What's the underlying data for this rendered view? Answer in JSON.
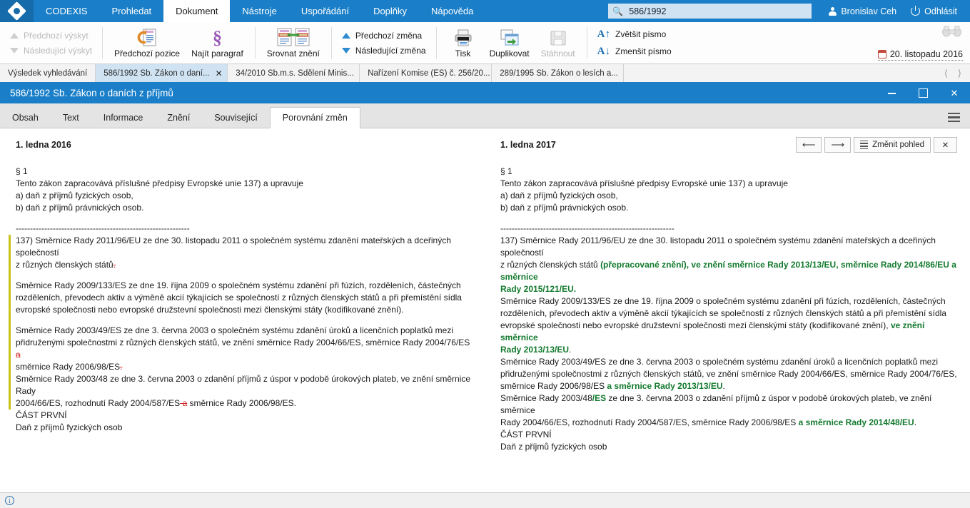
{
  "menubar": {
    "logo_icon": "codexis-diamond-logo",
    "items": [
      {
        "label": "CODEXIS",
        "active": false
      },
      {
        "label": "Prohledat",
        "active": false
      },
      {
        "label": "Dokument",
        "active": true
      },
      {
        "label": "Nástroje",
        "active": false
      },
      {
        "label": "Uspořádání",
        "active": false
      },
      {
        "label": "Doplňky",
        "active": false
      },
      {
        "label": "Nápověda",
        "active": false
      }
    ],
    "search": {
      "value": "586/1992",
      "placeholder": "",
      "icon": "search-icon"
    },
    "user": {
      "name": "Bronislav Ceh",
      "icon": "person-icon"
    },
    "logout": {
      "label": "Odhlásit",
      "icon": "power-icon"
    }
  },
  "ribbon": {
    "nav": {
      "prev_occurrence": "Předchozí výskyt",
      "next_occurrence": "Následující výskyt"
    },
    "prev_position": "Předchozí pozice",
    "find_paragraph": "Najít paragraf",
    "compare_versions": "Srovnat znění",
    "changes": {
      "prev_change": "Předchozí změna",
      "next_change": "Následující změna"
    },
    "print": "Tisk",
    "duplicate": "Duplikovat",
    "download": "Stáhnout",
    "font": {
      "increase": "Zvětšit písmo",
      "decrease": "Zmenšit písmo"
    },
    "binoculars_icon": "binoculars-icon",
    "date": "20. listopadu 2016",
    "date_icon": "calendar-icon"
  },
  "doctabs": {
    "items": [
      {
        "label": "Výsledek vyhledávání",
        "selected": false,
        "closable": false
      },
      {
        "label": "586/1992 Sb. Zákon o daní...",
        "selected": true,
        "closable": true
      },
      {
        "label": "34/2010 Sb.m.s. Sdělení Minis...",
        "selected": false,
        "closable": false
      },
      {
        "label": "Nařízení Komise (ES) č. 256/20...",
        "selected": false,
        "closable": false
      },
      {
        "label": "289/1995 Sb. Zákon o lesích a...",
        "selected": false,
        "closable": false
      }
    ],
    "nav_prev_icon": "chevron-left-icon",
    "nav_next_icon": "chevron-right-icon"
  },
  "window": {
    "title": "586/1992 Sb. Zákon o daních z příjmů",
    "minimize_icon": "minimize-icon",
    "maximize_icon": "maximize-icon",
    "close_icon": "close-icon"
  },
  "inner_tabs": {
    "items": [
      {
        "label": "Obsah",
        "active": false
      },
      {
        "label": "Text",
        "active": false
      },
      {
        "label": "Informace",
        "active": false
      },
      {
        "label": "Znění",
        "active": false
      },
      {
        "label": "Související",
        "active": false
      },
      {
        "label": "Porovnání změn",
        "active": true
      }
    ],
    "menu_icon": "hamburger-menu-icon"
  },
  "compare": {
    "left": {
      "date": "1. ledna 2016",
      "section": "§ 1",
      "intro": "Tento zákon zapracovává příslušné předpisy Evropské unie 137) a upravuje",
      "item_a": "a) daň z příjmů fyzických osob,",
      "item_b": "b) daň z příjmů právnických osob.",
      "divider": "-------------------------------------------------------------",
      "note137_p1": "137) Směrnice Rady 2011/96/EU ze dne 30. listopadu 2011 o společném systému zdanění mateřských a dceřiných společností",
      "note137_p2_pre": "z různých členských států",
      "note137_p2_del": ".",
      "note133_p1": "Směrnice Rady 2009/133/ES ze dne 19. října 2009 o společném systému zdanění při fúzích, rozděleních, částečných",
      "note133_p2": "rozděleních, převodech aktiv a výměně akcií týkajících se společností z různých členských států a při přemístění sídla",
      "note133_p3": "evropské společnosti nebo evropské družstevní společnosti mezi členskými státy (kodifikované znění).",
      "note49_p1": "Směrnice Rady 2003/49/ES ze dne 3. června 2003 o společném systému zdanění úroků a licenčních poplatků mezi",
      "note49_p2_pre": "přidruženými společnostmi z různých členských států, ve znění směrnice Rady 2004/66/ES, směrnice Rady 2004/76/ES",
      "note49_p2_del": " a",
      "note49_p3_pre": "směrnice Rady 2006/98/ES",
      "note49_p3_del": ".",
      "note48_p1": "Směrnice Rady 2003/48 ze dne 3. června 2003 o zdanění příjmů z úspor v podobě úrokových plateb, ve znění směrnice Rady",
      "note48_p2_pre": "2004/66/ES, rozhodnutí Rady 2004/587/ES",
      "note48_p2_del": " a",
      "note48_p2_post": " směrnice Rady 2006/98/ES.",
      "part_heading": "ČÁST PRVNÍ",
      "part_subtitle": "Daň z příjmů fyzických osob"
    },
    "right": {
      "date": "1. ledna 2017",
      "section": "§ 1",
      "intro": "Tento zákon zapracovává příslušné předpisy Evropské unie 137) a upravuje",
      "item_a": "a) daň z příjmů fyzických osob,",
      "item_b": "b) daň z příjmů právnických osob.",
      "divider": "-------------------------------------------------------------",
      "note137_p1": "137) Směrnice Rady 2011/96/EU ze dne 30. listopadu 2011 o společném systému zdanění mateřských a dceřiných společností",
      "note137_p2_pre": "z různých členských států ",
      "note137_p2_ins": "(přepracované znění), ve znění směrnice Rady 2013/13/EU, směrnice Rady 2014/86/EU a směrnice",
      "note137_p3_ins": "Rady 2015/121/EU.",
      "note133_p1": "Směrnice Rady 2009/133/ES ze dne 19. října 2009 o společném systému zdanění při fúzích, rozděleních, částečných",
      "note133_p2": "rozděleních, převodech aktiv a výměně akcií týkajících se společností z různých členských států a při přemístění sídla",
      "note133_p3_pre": "evropské společnosti nebo evropské družstevní společnosti mezi členskými státy (kodifikované znění), ",
      "note133_p3_ins": "ve znění směrnice",
      "note133_p4_ins": "Rady 2013/13/EU",
      "note133_p4_post": ".",
      "note49_p1": "Směrnice Rady 2003/49/ES ze dne 3. června 2003 o společném systému zdanění úroků a licenčních poplatků mezi",
      "note49_p2": "přidruženými společnostmi z různých členských států, ve znění směrnice Rady 2004/66/ES, směrnice Rady 2004/76/ES,",
      "note49_p3_pre": "směrnice Rady 2006/98/ES ",
      "note49_p3_ins": "a směrnice Rady 2013/13/EU",
      "note49_p3_post": ".",
      "note48_p1_pre": "Směrnice Rady 2003/48",
      "note48_p1_ins": "/ES",
      "note48_p1_post": " ze dne 3. června 2003 o zdanění příjmů z úspor v podobě úrokových plateb, ve znění směrnice",
      "note48_p2_pre": "Rady 2004/66/ES, rozhodnutí Rady 2004/587/ES, směrnice Rady 2006/98/ES ",
      "note48_p2_ins": "a směrnice Rady 2014/48/EU",
      "note48_p2_post": ".",
      "part_heading": "ČÁST PRVNÍ",
      "part_subtitle": "Daň z příjmů fyzických osob"
    },
    "controls": {
      "prev_label": "◀",
      "next_label": "▶",
      "change_view": "Změnit pohled",
      "close": "✕",
      "prev_icon": "arrow-left-icon",
      "next_icon": "arrow-right-icon",
      "view_icon": "list-lines-icon",
      "close_icon": "close-icon"
    }
  },
  "statusbar": {
    "info_icon": "info-icon",
    "text": ""
  },
  "colors": {
    "brand_blue": "#1a7fc8",
    "deleted_red": "#d0201e",
    "inserted_green": "#137a2e",
    "change_marker": "#c9c21a"
  }
}
